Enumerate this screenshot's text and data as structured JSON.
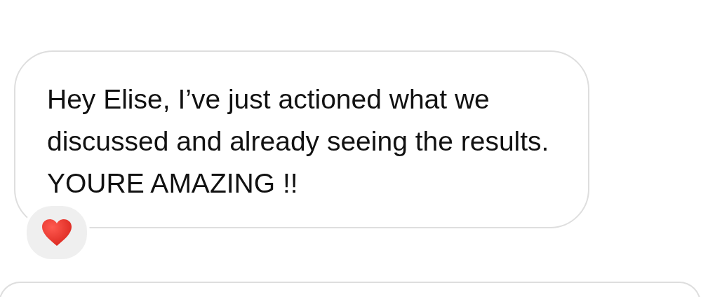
{
  "messages": [
    {
      "text": "Hey Elise, I’ve just actioned what we discussed and already seeing the results. YOURE AMAZING !!",
      "reacted": true
    }
  ]
}
